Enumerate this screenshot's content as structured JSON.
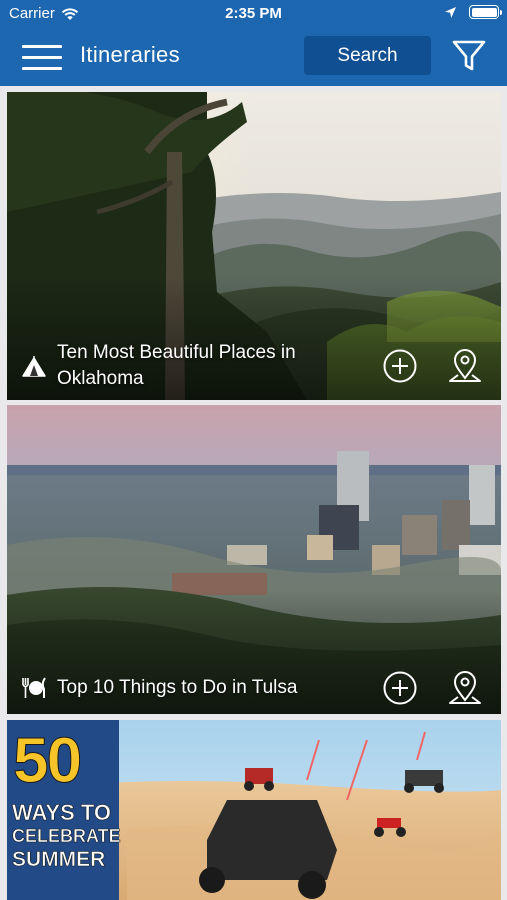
{
  "status_bar": {
    "carrier": "Carrier",
    "time": "2:35 PM"
  },
  "navbar": {
    "title": "Itineraries",
    "search_label": "Search"
  },
  "icons": {
    "menu": "hamburger-menu-icon",
    "filter": "filter-funnel-icon",
    "add": "plus-circle-icon",
    "map": "map-pin-icon"
  },
  "colors": {
    "bar_blue": "#1d66b0",
    "search_button": "#0f4f92",
    "promo_yellow": "#f4c428"
  },
  "itineraries": [
    {
      "title": "Ten Most Beautiful Places in Oklahoma",
      "category_icon": "tent-icon"
    },
    {
      "title": "Top 10 Things to Do in Tulsa",
      "category_icon": "dining-icon"
    },
    {
      "title": "",
      "category_icon": ""
    }
  ],
  "promo": {
    "number": "50",
    "line1": "WAYS TO",
    "line2": "CELEBRATE",
    "line3": "SUMMER"
  }
}
